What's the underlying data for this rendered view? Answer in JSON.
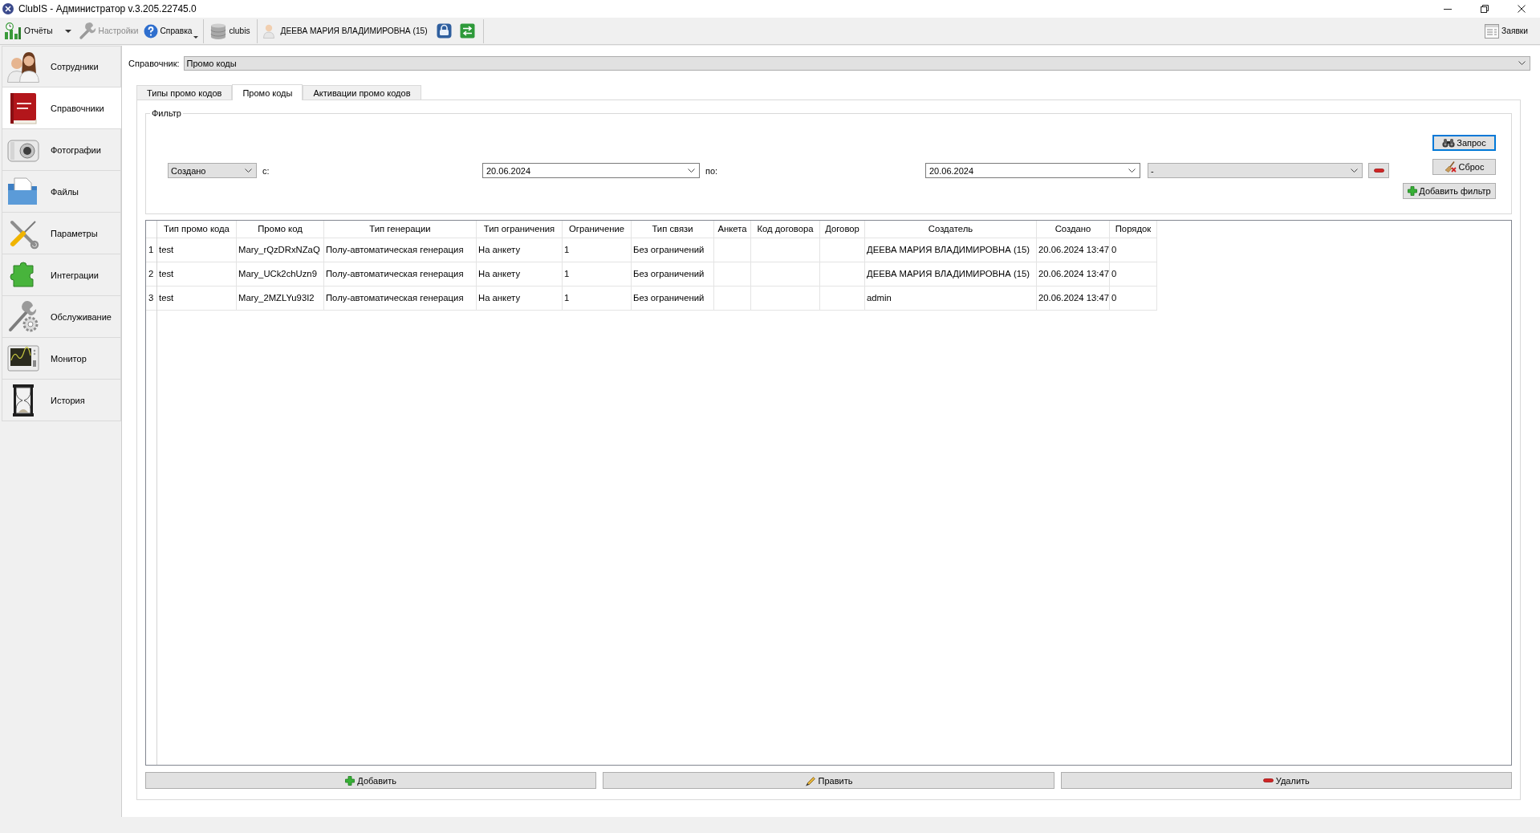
{
  "window": {
    "title": "ClubIS - Администратор v.3.205.22745.0"
  },
  "toolbar": {
    "groups": [
      {
        "items": [
          {
            "kind": "split_menu",
            "label": "Отчёты",
            "disabled": false
          },
          {
            "kind": "button",
            "label": "Настройки",
            "disabled": true
          },
          {
            "kind": "menu",
            "label": "Справка",
            "disabled": false
          }
        ]
      },
      {
        "items": [
          {
            "kind": "button",
            "label": "clubis",
            "disabled": false
          }
        ]
      },
      {
        "items": [
          {
            "kind": "user",
            "label": "ДЕЕВА МАРИЯ ВЛАДИМИРОВНА (15)",
            "disabled": false
          }
        ]
      }
    ],
    "right_item": {
      "label": "Заявки"
    }
  },
  "sidebar": {
    "items": [
      {
        "label": "Сотрудники",
        "selected": false
      },
      {
        "label": "Справочники",
        "selected": true
      },
      {
        "label": "Фотографии",
        "selected": false
      },
      {
        "label": "Файлы",
        "selected": false
      },
      {
        "label": "Параметры",
        "selected": false
      },
      {
        "label": "Интеграции",
        "selected": false
      },
      {
        "label": "Обслуживание",
        "selected": false
      },
      {
        "label": "Монитор",
        "selected": false
      },
      {
        "label": "История",
        "selected": false
      }
    ]
  },
  "directory": {
    "label": "Справочник:",
    "value": "Промо коды"
  },
  "tabs": [
    {
      "label": "Типы промо кодов",
      "selected": false
    },
    {
      "label": "Промо коды",
      "selected": true
    },
    {
      "label": "Активации промо кодов",
      "selected": false
    }
  ],
  "filter": {
    "title": "Фильтр",
    "field": "Создано",
    "from_label": "с:",
    "from": "20.06.2024",
    "to_label": "по:",
    "to": "20.06.2024",
    "condition": "-",
    "buttons": [
      {
        "label": "Запрос",
        "focused": true
      },
      {
        "label": "Сброс",
        "focused": false
      },
      {
        "label": "Добавить фильтр",
        "focused": false
      }
    ]
  },
  "table": {
    "columns": [
      "Тип промо кода",
      "Промо код",
      "Тип генерации",
      "Тип ограничения",
      "Ограничение",
      "Тип связи",
      "Анкета",
      "Код договора",
      "Договор",
      "Создатель",
      "Создано",
      "Порядок"
    ],
    "rows": [
      {
        "number": "1",
        "cells": [
          "test",
          "Mary_rQzDRxNZaQ",
          "Полу-автоматическая генерация",
          "На анкету",
          "1",
          "Без ограничений",
          null,
          null,
          null,
          "ДЕЕВА МАРИЯ ВЛАДИМИРОВНА (15)",
          "20.06.2024 13:47",
          "0"
        ]
      },
      {
        "number": "2",
        "cells": [
          "test",
          "Mary_UCk2chUzn9",
          "Полу-автоматическая генерация",
          "На анкету",
          "1",
          "Без ограничений",
          null,
          null,
          null,
          "ДЕЕВА МАРИЯ ВЛАДИМИРОВНА (15)",
          "20.06.2024 13:47",
          "0"
        ]
      },
      {
        "number": "3",
        "cells": [
          "test",
          "Mary_2MZLYu93I2",
          "Полу-автоматическая генерация",
          "На анкету",
          "1",
          "Без ограничений",
          null,
          null,
          null,
          "admin",
          "20.06.2024 13:47",
          "0"
        ]
      }
    ]
  },
  "actions": [
    "Добавить",
    "Править",
    "Удалить"
  ]
}
